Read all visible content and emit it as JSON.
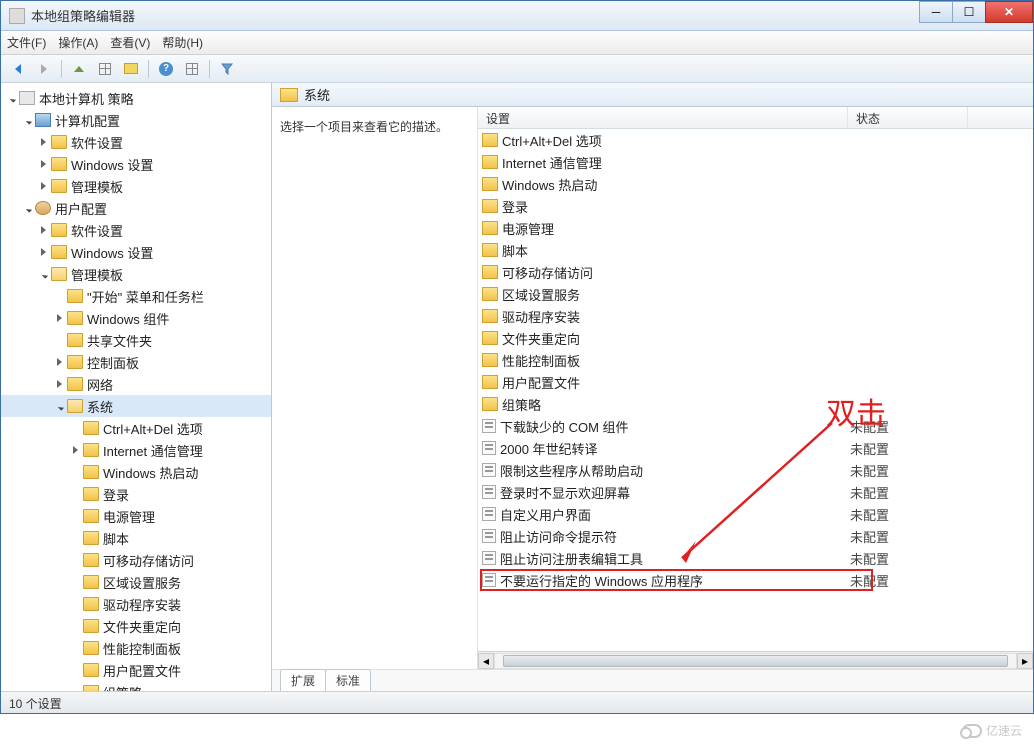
{
  "window": {
    "title": "本地组策略编辑器"
  },
  "menubar": {
    "file": "文件(F)",
    "action": "操作(A)",
    "view": "查看(V)",
    "help": "帮助(H)"
  },
  "tree": {
    "root": "本地计算机 策略",
    "computer_config": "计算机配置",
    "software_settings": "软件设置",
    "windows_settings": "Windows 设置",
    "admin_templates": "管理模板",
    "user_config": "用户配置",
    "start_menu": "\"开始\" 菜单和任务栏",
    "windows_components": "Windows 组件",
    "shared_folders": "共享文件夹",
    "control_panel": "控制面板",
    "network": "网络",
    "system": "系统",
    "ctrl_alt_del": "Ctrl+Alt+Del 选项",
    "internet_comm": "Internet 通信管理",
    "windows_hotstart": "Windows 热启动",
    "logon": "登录",
    "power_management": "电源管理",
    "scripts": "脚本",
    "removable_storage": "可移动存储访问",
    "locale_services": "区域设置服务",
    "driver_install": "驱动程序安装",
    "folder_redirect": "文件夹重定向",
    "perf_control": "性能控制面板",
    "user_profiles": "用户配置文件",
    "group_policy": "组策略"
  },
  "right": {
    "header": "系统",
    "desc": "选择一个项目来查看它的描述。",
    "columns": {
      "setting": "设置",
      "status": "状态"
    },
    "folders": [
      "Ctrl+Alt+Del 选项",
      "Internet 通信管理",
      "Windows 热启动",
      "登录",
      "电源管理",
      "脚本",
      "可移动存储访问",
      "区域设置服务",
      "驱动程序安装",
      "文件夹重定向",
      "性能控制面板",
      "用户配置文件",
      "组策略"
    ],
    "settings": [
      {
        "name": "下载缺少的 COM 组件",
        "status": "未配置"
      },
      {
        "name": "2000 年世纪转译",
        "status": "未配置"
      },
      {
        "name": "限制这些程序从帮助启动",
        "status": "未配置"
      },
      {
        "name": "登录时不显示欢迎屏幕",
        "status": "未配置"
      },
      {
        "name": "自定义用户界面",
        "status": "未配置"
      },
      {
        "name": "阻止访问命令提示符",
        "status": "未配置"
      },
      {
        "name": "阻止访问注册表编辑工具",
        "status": "未配置"
      },
      {
        "name": "不要运行指定的 Windows 应用程序",
        "status": "未配置",
        "highlight": true
      }
    ],
    "tabs": {
      "extended": "扩展",
      "standard": "标准"
    }
  },
  "statusbar": "10 个设置",
  "annotation": "双击",
  "watermark": "亿速云"
}
